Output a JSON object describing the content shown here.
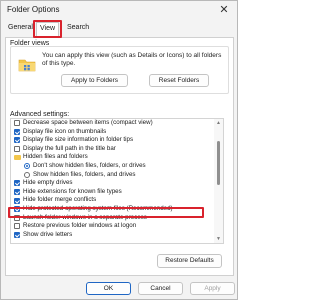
{
  "window": {
    "title": "Folder Options",
    "close_glyph": "✕"
  },
  "tabs": [
    {
      "label": "General"
    },
    {
      "label": "View",
      "selected": true
    },
    {
      "label": "Search"
    }
  ],
  "folder_views": {
    "title": "Folder views",
    "icon": "folder-icon",
    "description": "You can apply this view (such as Details or Icons) to all folders of this type.",
    "apply_button": "Apply to Folders",
    "reset_button": "Reset Folders"
  },
  "advanced": {
    "title": "Advanced settings:",
    "items": [
      {
        "type": "checkbox",
        "checked": false,
        "indent": 1,
        "label": "Decrease space between items (compact view)"
      },
      {
        "type": "checkbox",
        "checked": true,
        "indent": 1,
        "label": "Display file icon on thumbnails"
      },
      {
        "type": "checkbox",
        "checked": true,
        "indent": 1,
        "label": "Display file size information in folder tips"
      },
      {
        "type": "checkbox",
        "checked": false,
        "indent": 1,
        "label": "Display the full path in the title bar"
      },
      {
        "type": "folder",
        "indent": 1,
        "label": "Hidden files and folders"
      },
      {
        "type": "radio",
        "checked": true,
        "indent": 2,
        "label": "Don't show hidden files, folders, or drives"
      },
      {
        "type": "radio",
        "checked": false,
        "indent": 2,
        "label": "Show hidden files, folders, and drives"
      },
      {
        "type": "checkbox",
        "checked": true,
        "indent": 1,
        "label": "Hide empty drives"
      },
      {
        "type": "checkbox",
        "checked": true,
        "indent": 1,
        "label": "Hide extensions for known file types"
      },
      {
        "type": "checkbox",
        "checked": true,
        "indent": 1,
        "label": "Hide folder merge conflicts"
      },
      {
        "type": "checkbox",
        "checked": true,
        "indent": 1,
        "label": "Hide protected operating system files (Recommended)"
      },
      {
        "type": "checkbox",
        "checked": false,
        "indent": 1,
        "label": "Launch folder windows in a separate process"
      },
      {
        "type": "checkbox",
        "checked": false,
        "indent": 1,
        "label": "Restore previous folder windows at logon"
      },
      {
        "type": "checkbox",
        "checked": true,
        "indent": 1,
        "label": "Show drive letters"
      }
    ],
    "restore_button": "Restore Defaults"
  },
  "footer": {
    "ok": "OK",
    "cancel": "Cancel",
    "apply": "Apply"
  },
  "colors": {
    "accent": "#1f66c4",
    "highlight": "#d9232d",
    "folder": "#f3c64b"
  }
}
